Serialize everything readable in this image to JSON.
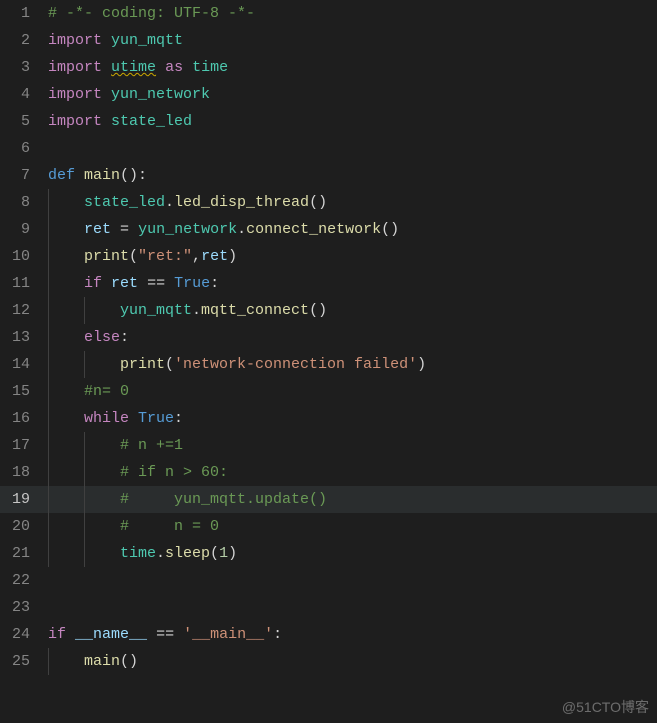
{
  "watermark": "@51CTO博客",
  "active_line": 19,
  "chart_data": null,
  "lines": [
    {
      "n": 1,
      "indent": 0,
      "tokens": [
        [
          "comment",
          "# -*- coding: UTF-8 -*-"
        ]
      ]
    },
    {
      "n": 2,
      "indent": 0,
      "tokens": [
        [
          "keyword",
          "import"
        ],
        [
          "punct",
          " "
        ],
        [
          "module",
          "yun_mqtt"
        ]
      ]
    },
    {
      "n": 3,
      "indent": 0,
      "tokens": [
        [
          "keyword",
          "import"
        ],
        [
          "punct",
          " "
        ],
        [
          "module-u",
          "utime"
        ],
        [
          "punct",
          " "
        ],
        [
          "keyword",
          "as"
        ],
        [
          "punct",
          " "
        ],
        [
          "module",
          "time"
        ]
      ]
    },
    {
      "n": 4,
      "indent": 0,
      "tokens": [
        [
          "keyword",
          "import"
        ],
        [
          "punct",
          " "
        ],
        [
          "module",
          "yun_network"
        ]
      ]
    },
    {
      "n": 5,
      "indent": 0,
      "tokens": [
        [
          "keyword",
          "import"
        ],
        [
          "punct",
          " "
        ],
        [
          "module",
          "state_led"
        ]
      ]
    },
    {
      "n": 6,
      "indent": 0,
      "tokens": []
    },
    {
      "n": 7,
      "indent": 0,
      "tokens": [
        [
          "def",
          "def"
        ],
        [
          "punct",
          " "
        ],
        [
          "funcname",
          "main"
        ],
        [
          "punct",
          "():"
        ]
      ]
    },
    {
      "n": 8,
      "indent": 1,
      "tokens": [
        [
          "obj",
          "state_led"
        ],
        [
          "punct",
          "."
        ],
        [
          "call",
          "led_disp_thread"
        ],
        [
          "punct",
          "()"
        ]
      ]
    },
    {
      "n": 9,
      "indent": 1,
      "tokens": [
        [
          "ident",
          "ret"
        ],
        [
          "punct",
          " "
        ],
        [
          "op",
          "="
        ],
        [
          "punct",
          " "
        ],
        [
          "obj",
          "yun_network"
        ],
        [
          "punct",
          "."
        ],
        [
          "call",
          "connect_network"
        ],
        [
          "punct",
          "()"
        ]
      ]
    },
    {
      "n": 10,
      "indent": 1,
      "tokens": [
        [
          "call",
          "print"
        ],
        [
          "punct",
          "("
        ],
        [
          "string",
          "\"ret:\""
        ],
        [
          "punct",
          ","
        ],
        [
          "ident",
          "ret"
        ],
        [
          "punct",
          ")"
        ]
      ]
    },
    {
      "n": 11,
      "indent": 1,
      "tokens": [
        [
          "keyword",
          "if"
        ],
        [
          "punct",
          " "
        ],
        [
          "ident",
          "ret"
        ],
        [
          "punct",
          " "
        ],
        [
          "op",
          "=="
        ],
        [
          "punct",
          " "
        ],
        [
          "const",
          "True"
        ],
        [
          "punct",
          ":"
        ]
      ]
    },
    {
      "n": 12,
      "indent": 2,
      "tokens": [
        [
          "obj",
          "yun_mqtt"
        ],
        [
          "punct",
          "."
        ],
        [
          "call",
          "mqtt_connect"
        ],
        [
          "punct",
          "()"
        ]
      ]
    },
    {
      "n": 13,
      "indent": 1,
      "tokens": [
        [
          "keyword",
          "else"
        ],
        [
          "punct",
          ":"
        ]
      ]
    },
    {
      "n": 14,
      "indent": 2,
      "tokens": [
        [
          "call",
          "print"
        ],
        [
          "punct",
          "("
        ],
        [
          "string",
          "'network-connection failed'"
        ],
        [
          "punct",
          ")"
        ]
      ]
    },
    {
      "n": 15,
      "indent": 1,
      "tokens": [
        [
          "comment",
          "#n= 0"
        ]
      ]
    },
    {
      "n": 16,
      "indent": 1,
      "tokens": [
        [
          "keyword",
          "while"
        ],
        [
          "punct",
          " "
        ],
        [
          "const",
          "True"
        ],
        [
          "punct",
          ":"
        ]
      ]
    },
    {
      "n": 17,
      "indent": 2,
      "tokens": [
        [
          "comment",
          "# n +=1"
        ]
      ]
    },
    {
      "n": 18,
      "indent": 2,
      "tokens": [
        [
          "comment",
          "# if n > 60:"
        ]
      ]
    },
    {
      "n": 19,
      "indent": 2,
      "tokens": [
        [
          "comment",
          "#     yun_mqtt.update()"
        ]
      ]
    },
    {
      "n": 20,
      "indent": 2,
      "tokens": [
        [
          "comment",
          "#     n = 0"
        ]
      ]
    },
    {
      "n": 21,
      "indent": 2,
      "tokens": [
        [
          "obj",
          "time"
        ],
        [
          "punct",
          "."
        ],
        [
          "call",
          "sleep"
        ],
        [
          "punct",
          "("
        ],
        [
          "num",
          "1"
        ],
        [
          "punct",
          ")"
        ]
      ]
    },
    {
      "n": 22,
      "indent": 0,
      "tokens": []
    },
    {
      "n": 23,
      "indent": 0,
      "tokens": []
    },
    {
      "n": 24,
      "indent": 0,
      "tokens": [
        [
          "keyword",
          "if"
        ],
        [
          "punct",
          " "
        ],
        [
          "ident",
          "__name__"
        ],
        [
          "punct",
          " "
        ],
        [
          "op",
          "=="
        ],
        [
          "punct",
          " "
        ],
        [
          "string",
          "'__main__'"
        ],
        [
          "punct",
          ":"
        ]
      ]
    },
    {
      "n": 25,
      "indent": 1,
      "tokens": [
        [
          "call",
          "main"
        ],
        [
          "punct",
          "()"
        ]
      ]
    }
  ]
}
